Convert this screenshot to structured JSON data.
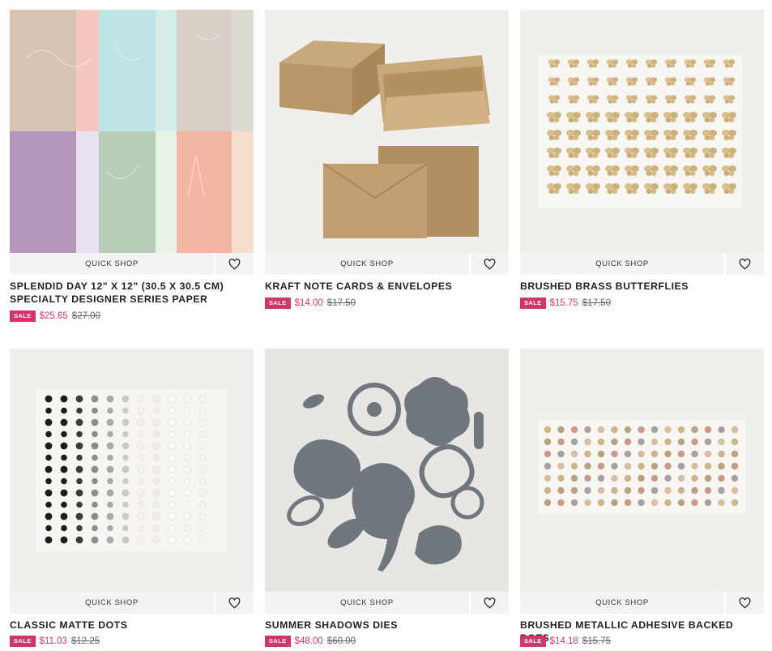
{
  "products": [
    {
      "title": "Splendid Day 12\" x 12\" (30.5 x 30.5 cm) Specialty Designer Series Paper",
      "quick_shop": "QUICK SHOP",
      "sale_badge": "SALE",
      "sale_price": "$25.65",
      "original_price": "$27.00",
      "icon": "heart-icon"
    },
    {
      "title": "Kraft Note Cards & Envelopes",
      "quick_shop": "QUICK SHOP",
      "sale_badge": "SALE",
      "sale_price": "$14.00",
      "original_price": "$17.50",
      "icon": "heart-icon"
    },
    {
      "title": "Brushed Brass Butterflies",
      "quick_shop": "QUICK SHOP",
      "sale_badge": "SALE",
      "sale_price": "$15.75",
      "original_price": "$17.50",
      "icon": "heart-icon"
    },
    {
      "title": "Classic Matte Dots",
      "quick_shop": "QUICK SHOP",
      "sale_badge": "SALE",
      "sale_price": "$11.03",
      "original_price": "$12.25",
      "icon": "heart-icon"
    },
    {
      "title": "Summer Shadows Dies",
      "quick_shop": "QUICK SHOP",
      "sale_badge": "SALE",
      "sale_price": "$48.00",
      "original_price": "$60.00",
      "icon": "heart-icon"
    },
    {
      "title": "Brushed Metallic Adhesive Backed Dots",
      "quick_shop": "QUICK SHOP",
      "sale_badge": "SALE",
      "sale_price": "$14.18",
      "original_price": "$15.75",
      "icon": "heart-icon"
    }
  ],
  "colors": {
    "sale_accent": "#d6336c",
    "quick_shop_bg": "#f3f3f3",
    "image_bg": "#f2f1ee"
  }
}
